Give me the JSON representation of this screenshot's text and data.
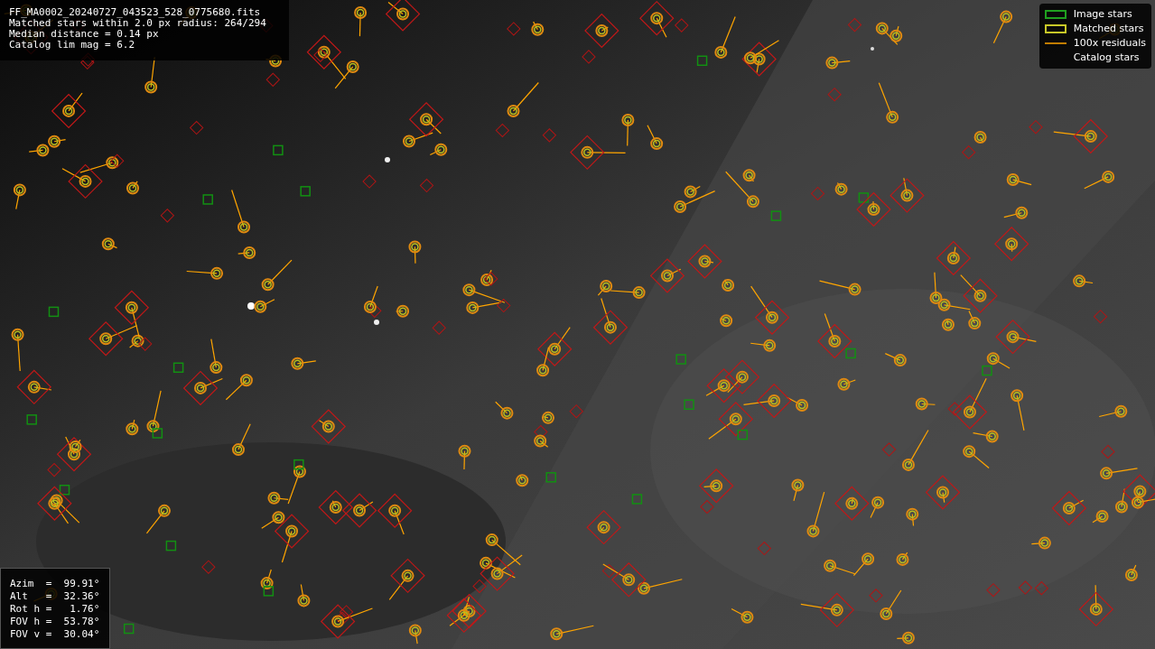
{
  "header_lines": [
    "FF_MA0002_20240727_043523_528_0775680.fits",
    "Matched stars within 2.0 px radius: 264/294",
    "Median distance = 0.14 px",
    "Catalog lim mag = 6.2"
  ],
  "legend": [
    {
      "label": "Image stars"
    },
    {
      "kind": "matched",
      "label": "Matched stars"
    },
    {
      "kind": "residual",
      "label": "100x residuals"
    },
    {
      "kind": "catalog",
      "label": "Catalog stars"
    }
  ],
  "pointing": [
    "Azim  =  99.91°",
    "Alt   =  32.36°",
    "Rot h =   1.76°",
    "FOV h =  53.78°",
    "FOV v =  30.04°"
  ]
}
